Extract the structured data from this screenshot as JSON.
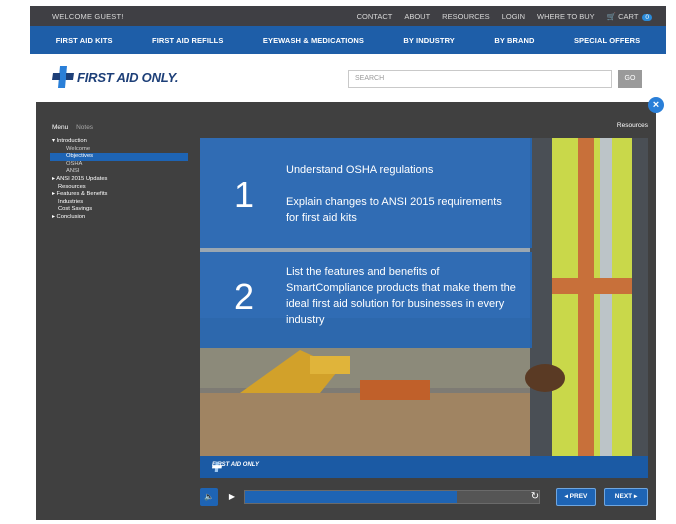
{
  "topbar": {
    "welcome": "WELCOME GUEST!",
    "links": [
      "CONTACT",
      "ABOUT",
      "RESOURCES",
      "LOGIN",
      "WHERE TO BUY"
    ],
    "cart_label": "CART",
    "cart_count": "0"
  },
  "nav": {
    "items": [
      "FIRST AID KITS",
      "FIRST AID REFILLS",
      "EYEWASH & MEDICATIONS",
      "BY INDUSTRY",
      "BY BRAND",
      "SPECIAL OFFERS"
    ]
  },
  "header": {
    "logo_text": "FIRST AID ONLY.",
    "search_placeholder": "SEARCH",
    "go_label": "GO"
  },
  "player": {
    "menu_label": "Menu",
    "notes_label": "Notes",
    "resources_label": "Resources",
    "menu_items": [
      {
        "label": "Introduction",
        "marker": "▾"
      },
      {
        "label": "Welcome",
        "marker": ""
      },
      {
        "label": "Objectives",
        "marker": ""
      },
      {
        "label": "OSHA",
        "marker": ""
      },
      {
        "label": "ANSI",
        "marker": ""
      },
      {
        "label": "ANSI 2015 Updates",
        "marker": "▸"
      },
      {
        "label": "Resources",
        "marker": ""
      },
      {
        "label": "Features & Benefits",
        "marker": "▸"
      },
      {
        "label": "Industries",
        "marker": ""
      },
      {
        "label": "Cost Savings",
        "marker": ""
      },
      {
        "label": "Conclusion",
        "marker": "▸"
      }
    ],
    "slide": {
      "objective1_number": "1",
      "objective1_line1": "Understand OSHA regulations",
      "objective1_line2": "Explain changes to ANSI 2015 requirements for first aid kits",
      "objective2_number": "2",
      "objective2_text": "List the features and benefits of SmartCompliance products that make them the ideal first aid solution for businesses in every industry",
      "footer_logo": "FIRST AID ONLY"
    },
    "controls": {
      "prev_label": "◂ PREV",
      "next_label": "NEXT ▸",
      "progress": 0.72
    }
  },
  "colors": {
    "brand_blue": "#1e5ea8",
    "dark_bar": "#3f3f44",
    "player_bg": "#404040",
    "accent": "#2a7fd8"
  }
}
